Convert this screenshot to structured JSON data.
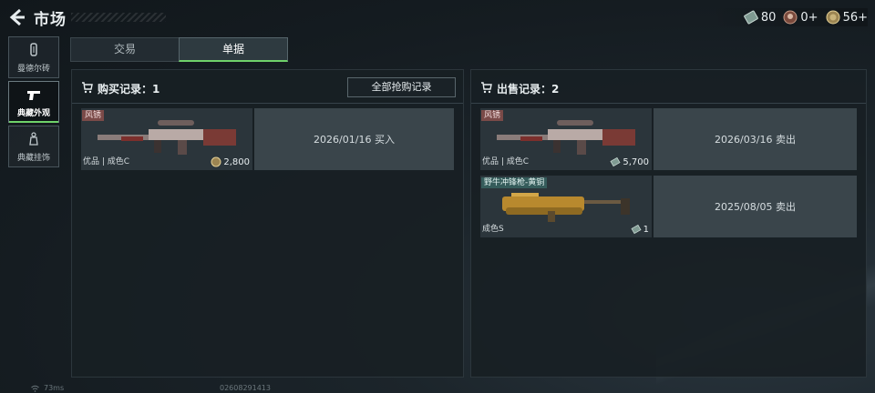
{
  "header": {
    "title": "市场"
  },
  "resources": [
    {
      "icon": "cash-icon",
      "value": "80"
    },
    {
      "icon": "token-icon",
      "value": "0+"
    },
    {
      "icon": "coin-icon",
      "value": "56+"
    }
  ],
  "sidebar": {
    "items": [
      {
        "label": "曼德尔砖",
        "active": false
      },
      {
        "label": "典藏外观",
        "active": true
      },
      {
        "label": "典藏挂饰",
        "active": false
      }
    ]
  },
  "tabs": {
    "trade": "交易",
    "records": "单据"
  },
  "buy": {
    "title": "购买记录：1",
    "button": "全部抢购记录",
    "records": [
      {
        "tag": "风锈",
        "quality": "优品 | 成色C",
        "price": "2,800",
        "date": "2026/01/16 买入"
      }
    ]
  },
  "sell": {
    "title": "出售记录：2",
    "records": [
      {
        "tag": "风锈",
        "quality": "优品 | 成色C",
        "price": "5,700",
        "date": "2026/03/16 卖出"
      },
      {
        "tag": "野牛冲锋枪-黄铜",
        "quality": "成色S",
        "price": "1",
        "date": "2025/08/05 卖出"
      }
    ]
  },
  "status": {
    "ping": "73ms",
    "uid": "02608291413"
  },
  "colors": {
    "accent": "#6fd26a",
    "tag_rust": "#7a4a48",
    "tag_teal": "#355c5b"
  }
}
